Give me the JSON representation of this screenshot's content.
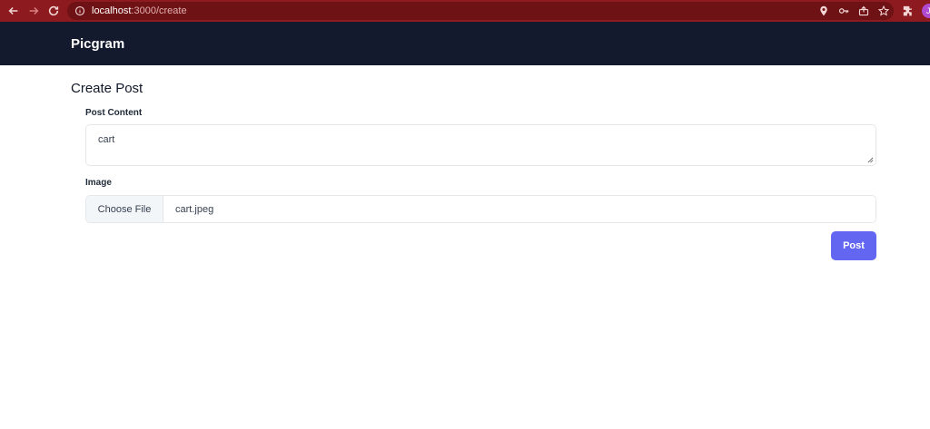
{
  "browser": {
    "url_host": "localhost",
    "url_path": ":3000/create",
    "profile_initial": "J"
  },
  "header": {
    "brand": "Picgram"
  },
  "main": {
    "title": "Create Post",
    "content_label": "Post Content",
    "content_value": "cart",
    "image_label": "Image",
    "choose_file_label": "Choose File",
    "file_name": "cart.jpeg",
    "submit_label": "Post"
  },
  "colors": {
    "browser_bar": "#8c1a1e",
    "header_bg": "#141a2e",
    "accent": "#6366f1"
  }
}
